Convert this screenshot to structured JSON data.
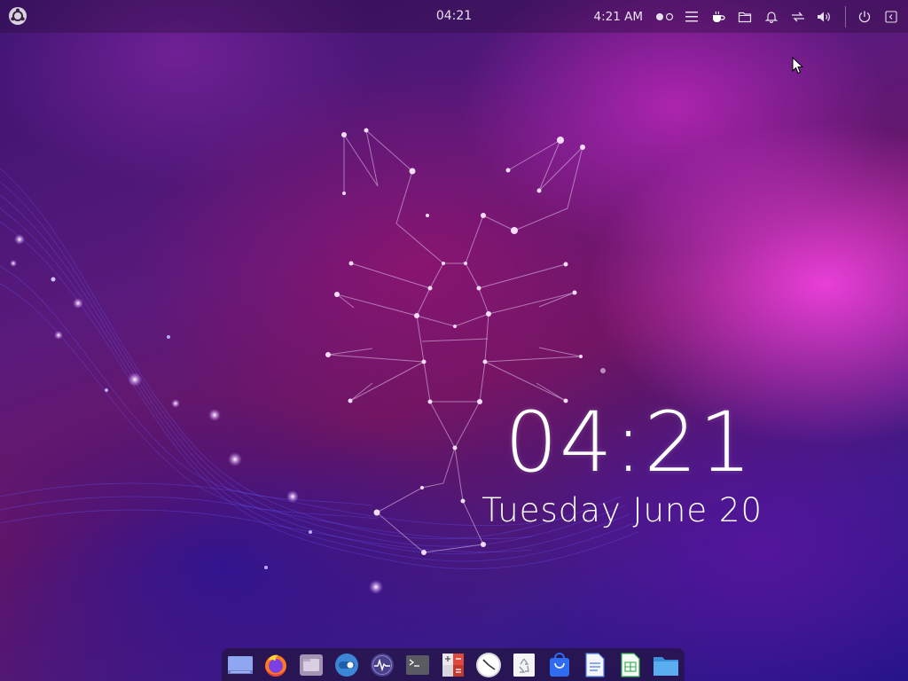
{
  "desktop": {
    "wallpaper": "constellation-scorpion-wallpaper",
    "accent_color": "#ff4ee8"
  },
  "top_panel": {
    "logo_icon": "ubuntu-budgie-logo-icon",
    "center_clock": "04:21",
    "tray_time": "4:21 AM",
    "tray_icons": [
      "workspace-switcher-icon",
      "menu-list-icon",
      "caffeine-cup-icon",
      "files-folder-icon",
      "notification-bell-icon",
      "network-arrows-icon",
      "volume-icon",
      "power-icon",
      "sidebar-toggle-icon"
    ]
  },
  "clock_widget": {
    "time": "04:21",
    "date": "Tuesday June 20"
  },
  "dock": {
    "apps": [
      "show-desktop-icon",
      "firefox-icon",
      "files-manager-icon",
      "toggle-settings-icon",
      "system-monitor-icon",
      "terminal-icon",
      "calculator-icon",
      "clock-app-icon",
      "recycle-bin-icon",
      "software-store-icon",
      "document-writer-icon",
      "spreadsheet-icon",
      "folder-icon"
    ]
  }
}
